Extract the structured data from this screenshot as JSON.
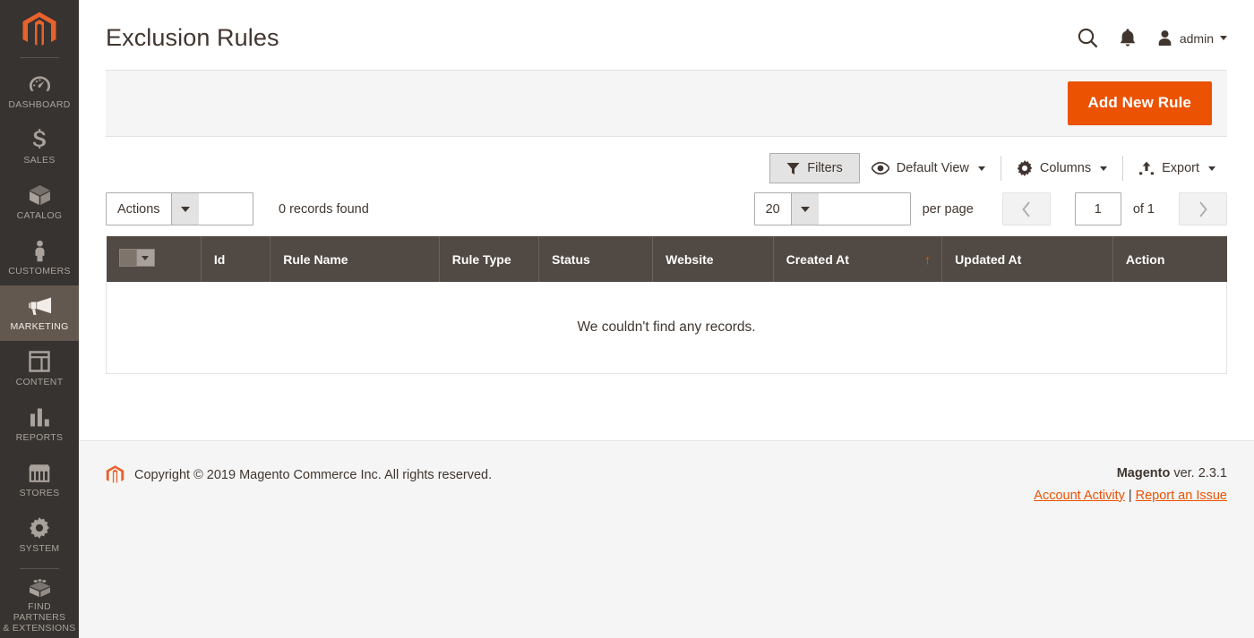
{
  "sidebar": {
    "logo": "magento-logo",
    "items": [
      {
        "label": "DASHBOARD",
        "icon": "dashboard-icon",
        "active": false
      },
      {
        "label": "SALES",
        "icon": "dollar-icon",
        "active": false
      },
      {
        "label": "CATALOG",
        "icon": "box-icon",
        "active": false
      },
      {
        "label": "CUSTOMERS",
        "icon": "person-icon",
        "active": false
      },
      {
        "label": "MARKETING",
        "icon": "megaphone-icon",
        "active": true
      },
      {
        "label": "CONTENT",
        "icon": "layout-icon",
        "active": false
      },
      {
        "label": "REPORTS",
        "icon": "bar-chart-icon",
        "active": false
      },
      {
        "label": "STORES",
        "icon": "storefront-icon",
        "active": false
      },
      {
        "label": "SYSTEM",
        "icon": "gear-icon",
        "active": false
      },
      {
        "label": "FIND PARTNERS\n& EXTENSIONS",
        "icon": "puzzle-block-icon",
        "active": false
      }
    ],
    "find_partners_line1": "FIND PARTNERS",
    "find_partners_line2": "& EXTENSIONS"
  },
  "header": {
    "title": "Exclusion Rules",
    "search_icon": "search-icon",
    "notifications_icon": "bell-icon",
    "avatar_icon": "user-avatar-icon",
    "admin_name": "admin"
  },
  "page_actions": {
    "add_new_rule_label": "Add New Rule"
  },
  "toolbar": {
    "filters_label": "Filters",
    "default_view_label": "Default View",
    "columns_label": "Columns",
    "export_label": "Export"
  },
  "controls": {
    "actions_label": "Actions",
    "records_found": "0 records found",
    "per_page_value": "20",
    "per_page_label": "per page",
    "current_page": "1",
    "of_pages": "of 1"
  },
  "grid": {
    "columns": [
      {
        "label": "",
        "name": "checkbox"
      },
      {
        "label": "Id",
        "name": "id"
      },
      {
        "label": "Rule Name",
        "name": "rule-name"
      },
      {
        "label": "Rule Type",
        "name": "rule-type"
      },
      {
        "label": "Status",
        "name": "status"
      },
      {
        "label": "Website",
        "name": "website"
      },
      {
        "label": "Created At",
        "name": "created-at",
        "sorted": "asc",
        "sort_glyph": "↑"
      },
      {
        "label": "Updated At",
        "name": "updated-at"
      },
      {
        "label": "Action",
        "name": "action"
      }
    ],
    "col_id": "Id",
    "col_rule_name": "Rule Name",
    "col_rule_type": "Rule Type",
    "col_status": "Status",
    "col_website": "Website",
    "col_created_at": "Created At",
    "col_updated_at": "Updated At",
    "col_action": "Action",
    "sort_glyph": "↑",
    "rows": [],
    "empty_message": "We couldn't find any records."
  },
  "footer": {
    "copyright": "Copyright © 2019 Magento Commerce Inc. All rights reserved.",
    "brand": "Magento",
    "version": " ver. 2.3.1",
    "account_activity_label": "Account Activity",
    "separator": "|",
    "report_issue_label": "Report an Issue"
  },
  "colors": {
    "accent_orange": "#eb5202",
    "sidebar_bg": "#373330",
    "sidebar_active": "#63584f",
    "table_header_bg": "#514943",
    "panel_bg": "#f5f5f5",
    "text_dark": "#41362f"
  }
}
